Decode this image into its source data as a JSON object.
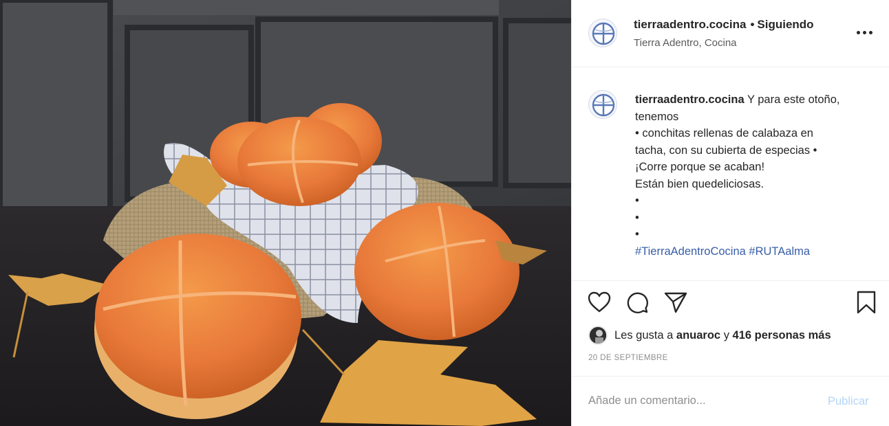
{
  "post": {
    "username": "tierraadentro.cocina",
    "separator": "•",
    "follow_status": "Siguiendo",
    "location": "Tierra Adentro, Cocina",
    "more_icon": "more-horizontal-icon"
  },
  "caption": {
    "username": "tierraadentro.cocina",
    "lines": [
      "Y para este otoño,",
      "tenemos",
      "• conchitas rellenas de calabaza en",
      "tacha, con su cubierta de especias •",
      "¡Corre porque se acaban!",
      "Están bien quedeliciosas.",
      "•",
      "•",
      "•"
    ],
    "hashtags": [
      "#TierraAdentroCocina",
      "#RUTAalma"
    ]
  },
  "actions": {
    "icons": [
      "heart-icon",
      "comment-icon",
      "share-icon",
      "bookmark-icon"
    ]
  },
  "likes": {
    "prefix": "Les gusta a",
    "user": "anuaroc",
    "middle": "y",
    "count_text": "416 personas más"
  },
  "date": "20 DE SEPTIEMBRE",
  "comment": {
    "placeholder": "Añade un comentario...",
    "publish_label": "Publicar"
  },
  "colors": {
    "link": "#385ea8",
    "publish_disabled": "#b3d6f9",
    "muted": "#8e8e8e"
  }
}
